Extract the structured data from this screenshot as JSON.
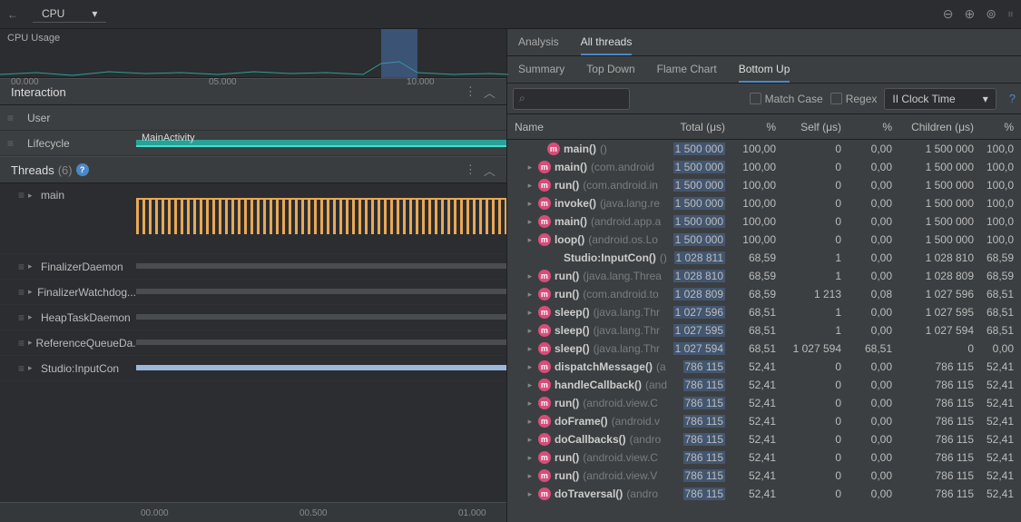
{
  "topbar": {
    "title": "CPU"
  },
  "cpuUsage": {
    "label": "CPU Usage",
    "times": [
      "00.000",
      "05.000",
      "10.000"
    ],
    "highlightLeft": 420,
    "highlightWidth": 40
  },
  "interaction": {
    "title": "Interaction",
    "rows": [
      {
        "label": "User"
      },
      {
        "label": "Lifecycle",
        "activity": "MainActivity"
      }
    ]
  },
  "threads": {
    "title": "Threads",
    "count": "(6)",
    "items": [
      {
        "label": "main",
        "tall": true,
        "orange": true
      },
      {
        "label": "FinalizerDaemon",
        "gray": true
      },
      {
        "label": "FinalizerWatchdog...",
        "gray": true
      },
      {
        "label": "HeapTaskDaemon",
        "gray": true
      },
      {
        "label": "ReferenceQueueDa...",
        "gray": true
      },
      {
        "label": "Studio:InputCon",
        "blue": true
      }
    ]
  },
  "bottomRuler": [
    "00.000",
    "00.500",
    "01.000"
  ],
  "analysisTabs": {
    "primary": [
      "Analysis",
      "All threads"
    ],
    "activePrimary": 1,
    "secondary": [
      "Summary",
      "Top Down",
      "Flame Chart",
      "Bottom Up"
    ],
    "activeSecondary": 3
  },
  "filter": {
    "matchCase": "Match Case",
    "regex": "Regex",
    "clock": "II Clock Time"
  },
  "table": {
    "headers": [
      "Name",
      "Total (μs)",
      "%",
      "Self (μs)",
      "%",
      "Children (μs)",
      "%"
    ],
    "rows": [
      {
        "indent": 18,
        "expand": false,
        "name": "main()",
        "pkg": "()",
        "total": "1 500 000",
        "pct": "100,00",
        "self": "0",
        "spct": "0,00",
        "child": "1 500 000",
        "cpct": "100,0"
      },
      {
        "indent": 8,
        "expand": true,
        "name": "main()",
        "pkg": "(com.android",
        "total": "1 500 000",
        "pct": "100,00",
        "self": "0",
        "spct": "0,00",
        "child": "1 500 000",
        "cpct": "100,0"
      },
      {
        "indent": 8,
        "expand": true,
        "name": "run()",
        "pkg": "(com.android.in",
        "total": "1 500 000",
        "pct": "100,00",
        "self": "0",
        "spct": "0,00",
        "child": "1 500 000",
        "cpct": "100,0"
      },
      {
        "indent": 8,
        "expand": true,
        "name": "invoke()",
        "pkg": "(java.lang.re",
        "total": "1 500 000",
        "pct": "100,00",
        "self": "0",
        "spct": "0,00",
        "child": "1 500 000",
        "cpct": "100,0"
      },
      {
        "indent": 8,
        "expand": true,
        "name": "main()",
        "pkg": "(android.app.a",
        "total": "1 500 000",
        "pct": "100,00",
        "self": "0",
        "spct": "0,00",
        "child": "1 500 000",
        "cpct": "100,0"
      },
      {
        "indent": 8,
        "expand": true,
        "name": "loop()",
        "pkg": "(android.os.Lo",
        "total": "1 500 000",
        "pct": "100,00",
        "self": "0",
        "spct": "0,00",
        "child": "1 500 000",
        "cpct": "100,0"
      },
      {
        "indent": 18,
        "expand": false,
        "noBadge": true,
        "name": "Studio:InputCon()",
        "pkg": "()",
        "total": "1 028 811",
        "pct": "68,59",
        "self": "1",
        "spct": "0,00",
        "child": "1 028 810",
        "cpct": "68,59"
      },
      {
        "indent": 8,
        "expand": true,
        "name": "run()",
        "pkg": "(java.lang.Threa",
        "total": "1 028 810",
        "pct": "68,59",
        "self": "1",
        "spct": "0,00",
        "child": "1 028 809",
        "cpct": "68,59"
      },
      {
        "indent": 8,
        "expand": true,
        "name": "run()",
        "pkg": "(com.android.to",
        "total": "1 028 809",
        "pct": "68,59",
        "self": "1 213",
        "spct": "0,08",
        "child": "1 027 596",
        "cpct": "68,51"
      },
      {
        "indent": 8,
        "expand": true,
        "name": "sleep()",
        "pkg": "(java.lang.Thr",
        "total": "1 027 596",
        "pct": "68,51",
        "self": "1",
        "spct": "0,00",
        "child": "1 027 595",
        "cpct": "68,51"
      },
      {
        "indent": 8,
        "expand": true,
        "name": "sleep()",
        "pkg": "(java.lang.Thr",
        "total": "1 027 595",
        "pct": "68,51",
        "self": "1",
        "spct": "0,00",
        "child": "1 027 594",
        "cpct": "68,51"
      },
      {
        "indent": 8,
        "expand": true,
        "name": "sleep()",
        "pkg": "(java.lang.Thr",
        "total": "1 027 594",
        "pct": "68,51",
        "self": "1 027 594",
        "spct": "68,51",
        "child": "0",
        "cpct": "0,00"
      },
      {
        "indent": 8,
        "expand": true,
        "name": "dispatchMessage()",
        "pkg": "(a",
        "total": "786 115",
        "pct": "52,41",
        "self": "0",
        "spct": "0,00",
        "child": "786 115",
        "cpct": "52,41"
      },
      {
        "indent": 8,
        "expand": true,
        "name": "handleCallback()",
        "pkg": "(and",
        "total": "786 115",
        "pct": "52,41",
        "self": "0",
        "spct": "0,00",
        "child": "786 115",
        "cpct": "52,41"
      },
      {
        "indent": 8,
        "expand": true,
        "name": "run()",
        "pkg": "(android.view.C",
        "total": "786 115",
        "pct": "52,41",
        "self": "0",
        "spct": "0,00",
        "child": "786 115",
        "cpct": "52,41"
      },
      {
        "indent": 8,
        "expand": true,
        "name": "doFrame()",
        "pkg": "(android.v",
        "total": "786 115",
        "pct": "52,41",
        "self": "0",
        "spct": "0,00",
        "child": "786 115",
        "cpct": "52,41"
      },
      {
        "indent": 8,
        "expand": true,
        "name": "doCallbacks()",
        "pkg": "(andro",
        "total": "786 115",
        "pct": "52,41",
        "self": "0",
        "spct": "0,00",
        "child": "786 115",
        "cpct": "52,41"
      },
      {
        "indent": 8,
        "expand": true,
        "name": "run()",
        "pkg": "(android.view.C",
        "total": "786 115",
        "pct": "52,41",
        "self": "0",
        "spct": "0,00",
        "child": "786 115",
        "cpct": "52,41"
      },
      {
        "indent": 8,
        "expand": true,
        "name": "run()",
        "pkg": "(android.view.V",
        "total": "786 115",
        "pct": "52,41",
        "self": "0",
        "spct": "0,00",
        "child": "786 115",
        "cpct": "52,41"
      },
      {
        "indent": 8,
        "expand": true,
        "name": "doTraversal()",
        "pkg": "(andro",
        "total": "786 115",
        "pct": "52,41",
        "self": "0",
        "spct": "0,00",
        "child": "786 115",
        "cpct": "52,41"
      }
    ]
  }
}
